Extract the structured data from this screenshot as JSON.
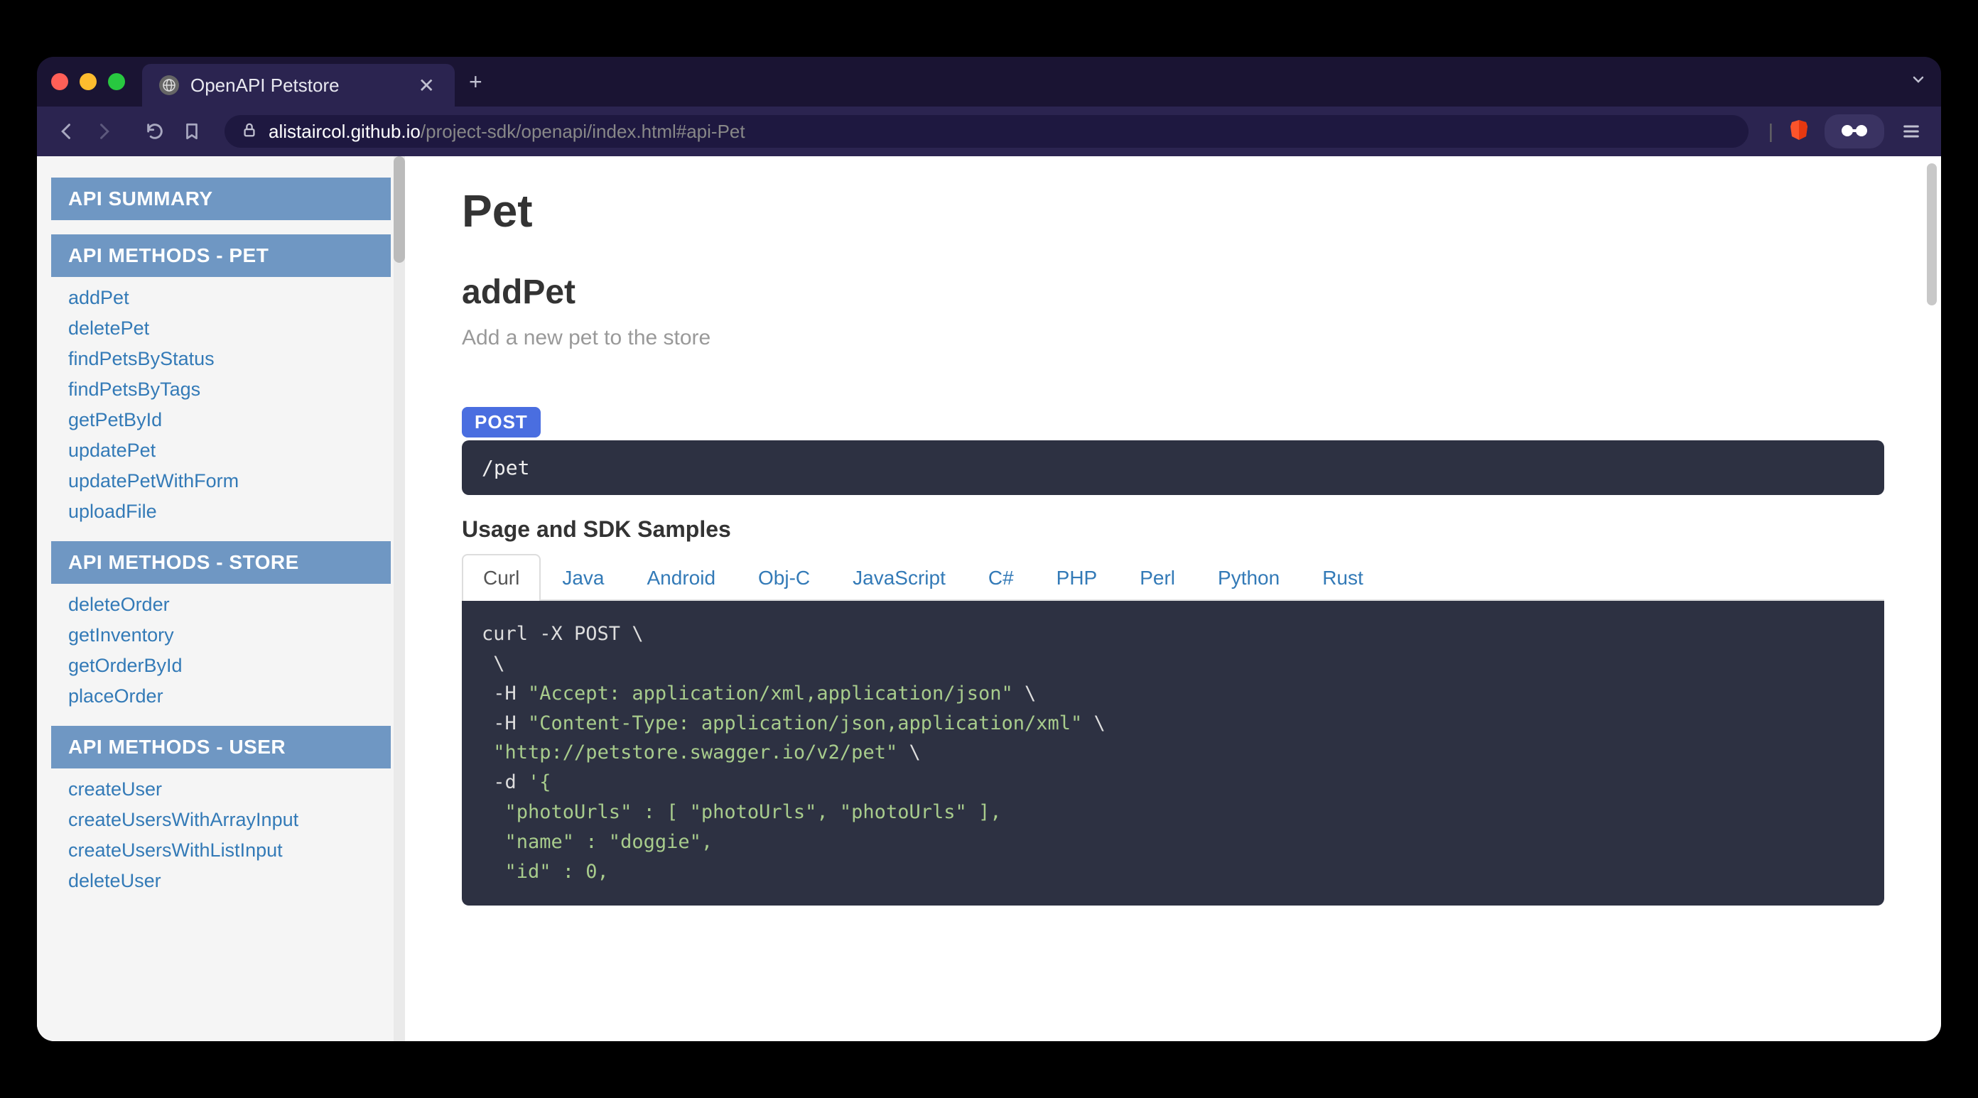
{
  "browser": {
    "tab_title": "OpenAPI Petstore",
    "url_domain": "alistaircol.github.io",
    "url_path": "/project-sdk/openapi/index.html#api-Pet"
  },
  "sidebar": {
    "sections": [
      {
        "title": "API SUMMARY",
        "items": []
      },
      {
        "title": "API METHODS - PET",
        "items": [
          "addPet",
          "deletePet",
          "findPetsByStatus",
          "findPetsByTags",
          "getPetById",
          "updatePet",
          "updatePetWithForm",
          "uploadFile"
        ]
      },
      {
        "title": "API METHODS - STORE",
        "items": [
          "deleteOrder",
          "getInventory",
          "getOrderById",
          "placeOrder"
        ]
      },
      {
        "title": "API METHODS - USER",
        "items": [
          "createUser",
          "createUsersWithArrayInput",
          "createUsersWithListInput",
          "deleteUser"
        ]
      }
    ]
  },
  "main": {
    "page_title": "Pet",
    "method_title": "addPet",
    "method_desc": "Add a new pet to the store",
    "http_method": "POST",
    "endpoint": "/pet",
    "samples_title": "Usage and SDK Samples",
    "code_tabs": [
      "Curl",
      "Java",
      "Android",
      "Obj-C",
      "JavaScript",
      "C#",
      "PHP",
      "Perl",
      "Python",
      "Rust"
    ],
    "active_tab": "Curl",
    "curl": {
      "l1": "curl -X POST \\",
      "l2": " \\",
      "l3a": " -H ",
      "l3b": "\"Accept: application/xml,application/json\"",
      "l3c": " \\",
      "l4a": " -H ",
      "l4b": "\"Content-Type: application/json,application/xml\"",
      "l4c": " \\",
      "l5a": " ",
      "l5b": "\"http://petstore.swagger.io/v2/pet\"",
      "l5c": " \\",
      "l6a": " -d ",
      "l6b": "'{",
      "l7": "  \"photoUrls\" : [ \"photoUrls\", \"photoUrls\" ],",
      "l8": "  \"name\" : \"doggie\",",
      "l9": "  \"id\" : 0,"
    }
  }
}
